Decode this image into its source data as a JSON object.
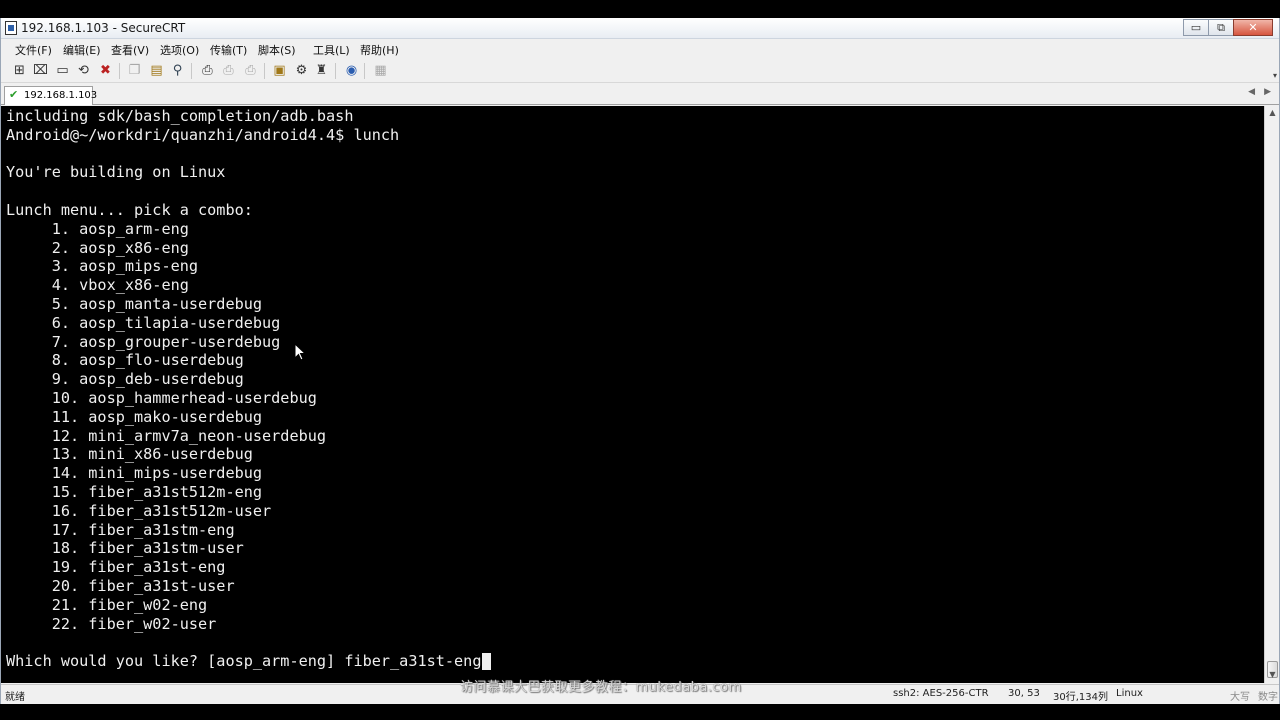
{
  "window": {
    "title": "192.168.1.103 - SecureCRT",
    "controls": {
      "minimize": "▭",
      "maximize": "⧉",
      "close": "✕"
    }
  },
  "menu": [
    "文件(F)",
    "编辑(E)",
    "查看(V)",
    "选项(O)",
    "传输(T)",
    "脚本(S)",
    "工具(L)",
    "帮助(H)"
  ],
  "toolbar": {
    "icons": [
      "connect-icon",
      "quick-connect-icon",
      "connect-tab-icon",
      "reconnect-icon",
      "disconnect-icon",
      "copy-icon",
      "paste-icon",
      "find-icon",
      "print-icon",
      "print-selection-icon",
      "print-setup-icon",
      "session-options-icon",
      "global-options-icon",
      "keymap-icon",
      "help-icon",
      "sftp-icon"
    ]
  },
  "tab": {
    "label": "192.168.1.103",
    "status": "connected"
  },
  "terminal": {
    "lines": [
      "including sdk/bash_completion/adb.bash",
      "Android@~/workdri/quanzhi/android4.4$ lunch",
      "",
      "You're building on Linux",
      "",
      "Lunch menu... pick a combo:",
      "     1. aosp_arm-eng",
      "     2. aosp_x86-eng",
      "     3. aosp_mips-eng",
      "     4. vbox_x86-eng",
      "     5. aosp_manta-userdebug",
      "     6. aosp_tilapia-userdebug",
      "     7. aosp_grouper-userdebug",
      "     8. aosp_flo-userdebug",
      "     9. aosp_deb-userdebug",
      "     10. aosp_hammerhead-userdebug",
      "     11. aosp_mako-userdebug",
      "     12. mini_armv7a_neon-userdebug",
      "     13. mini_x86-userdebug",
      "     14. mini_mips-userdebug",
      "     15. fiber_a31st512m-eng",
      "     16. fiber_a31st512m-user",
      "     17. fiber_a31stm-eng",
      "     18. fiber_a31stm-user",
      "     19. fiber_a31st-eng",
      "     20. fiber_a31st-user",
      "     21. fiber_w02-eng",
      "     22. fiber_w02-user",
      "",
      "Which would you like? [aosp_arm-eng] fiber_a31st-eng"
    ]
  },
  "status": {
    "ready": "就绪",
    "cipher": "ssh2: AES-256-CTR",
    "cursor": "30, 53",
    "size": "30行,134列",
    "os": "Linux",
    "caps": "大写",
    "num": "数字"
  },
  "watermark": "访问慕课大巴获取更多教程：mukedaba.com",
  "colors": {
    "terminal_bg": "#000000",
    "terminal_fg": "#f0f0f0",
    "chrome": "#f0f0f0"
  }
}
